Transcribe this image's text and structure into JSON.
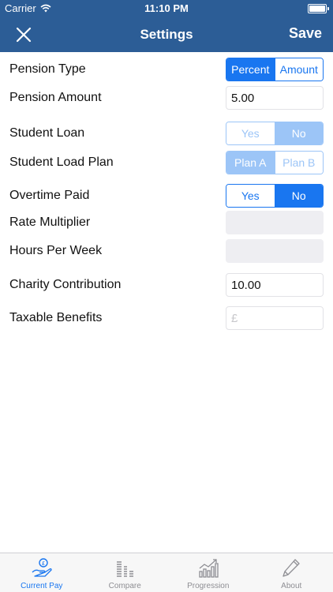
{
  "status": {
    "carrier": "Carrier",
    "time": "11:10 PM"
  },
  "nav": {
    "title": "Settings",
    "save": "Save"
  },
  "settings": {
    "pension_type": {
      "label": "Pension Type",
      "options": [
        "Percent",
        "Amount"
      ],
      "selected": "Percent"
    },
    "pension_amount": {
      "label": "Pension Amount",
      "value": "5.00"
    },
    "student_loan": {
      "label": "Student Loan",
      "options": [
        "Yes",
        "No"
      ],
      "selected": "No"
    },
    "student_load_plan": {
      "label": "Student Load Plan",
      "options": [
        "Plan A",
        "Plan B"
      ],
      "selected": "Plan A"
    },
    "overtime_paid": {
      "label": "Overtime Paid",
      "options": [
        "Yes",
        "No"
      ],
      "selected": "No"
    },
    "rate_multiplier": {
      "label": "Rate Multiplier",
      "value": ""
    },
    "hours_per_week": {
      "label": "Hours Per Week",
      "value": ""
    },
    "charity_contribution": {
      "label": "Charity Contribution",
      "value": "10.00"
    },
    "taxable_benefits": {
      "label": "Taxable Benefits",
      "placeholder": "£"
    }
  },
  "tabs": [
    {
      "label": "Current Pay",
      "icon": "hand-coin-icon",
      "active": true
    },
    {
      "label": "Compare",
      "icon": "bar-compare-icon",
      "active": false
    },
    {
      "label": "Progression",
      "icon": "trend-chart-icon",
      "active": false
    },
    {
      "label": "About",
      "icon": "pencil-icon",
      "active": false
    }
  ],
  "colors": {
    "nav": "#2c5d96",
    "accent": "#1976f0",
    "accent_disabled": "#9cc5f7"
  }
}
